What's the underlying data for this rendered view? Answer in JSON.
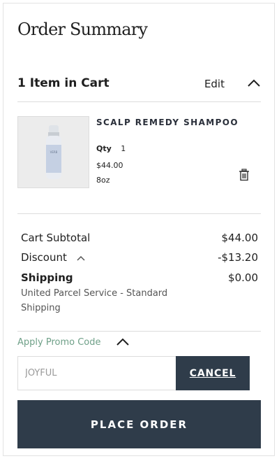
{
  "summary": {
    "title": "Order Summary"
  },
  "cart": {
    "count_label": "1 Item in Cart",
    "edit_label": "Edit",
    "item": {
      "name": "SCALP REMEDY SHAMPOO",
      "qty_label": "Qty",
      "qty": "1",
      "price": "$44.00",
      "size": "8oz",
      "image_caption": "VERB"
    }
  },
  "totals": {
    "subtotal_label": "Cart Subtotal",
    "subtotal_value": "$44.00",
    "discount_label": "Discount",
    "discount_value": "-$13.20",
    "shipping_label": "Shipping",
    "shipping_value": "$0.00",
    "shipping_method": "United Parcel Service - Standard Shipping"
  },
  "promo": {
    "label": "Apply Promo Code",
    "code": "JOYFUL",
    "cancel_label": "CANCEL"
  },
  "checkout": {
    "place_order_label": "PLACE ORDER"
  },
  "colors": {
    "primary": "#2f3c4a",
    "promo_link": "#6fa088",
    "divider": "#dcdcdc"
  }
}
